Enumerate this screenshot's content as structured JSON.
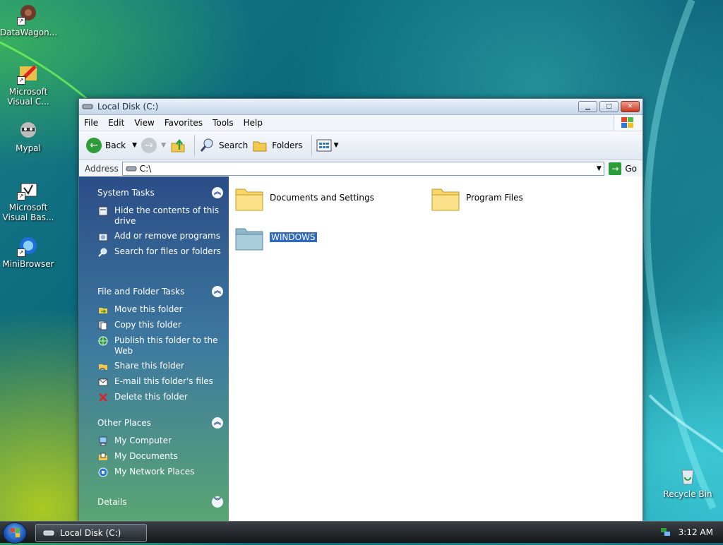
{
  "desktop": {
    "icons": [
      {
        "label": "DataWagon..."
      },
      {
        "label": "Microsoft Visual C..."
      },
      {
        "label": "Mypal"
      },
      {
        "label": "Microsoft Visual Bas..."
      },
      {
        "label": "MiniBrowser"
      }
    ],
    "recycle_bin": "Recycle Bin"
  },
  "window": {
    "title": "Local Disk (C:)",
    "menu": [
      "File",
      "Edit",
      "View",
      "Favorites",
      "Tools",
      "Help"
    ],
    "toolbar": {
      "back": "Back",
      "search": "Search",
      "folders": "Folders"
    },
    "address": {
      "label": "Address",
      "value": "C:\\",
      "go": "Go"
    }
  },
  "sidepane": {
    "system_tasks": {
      "title": "System Tasks",
      "items": [
        "Hide the contents of this drive",
        "Add or remove programs",
        "Search for files or folders"
      ]
    },
    "file_folder_tasks": {
      "title": "File and Folder Tasks",
      "items": [
        "Move this folder",
        "Copy this folder",
        "Publish this folder to the Web",
        "Share this folder",
        "E-mail this folder's files",
        "Delete this folder"
      ]
    },
    "other_places": {
      "title": "Other Places",
      "items": [
        "My Computer",
        "My Documents",
        "My Network Places"
      ]
    },
    "details": {
      "title": "Details"
    }
  },
  "content": {
    "folders": [
      "Documents and Settings",
      "Program Files",
      "WINDOWS"
    ],
    "selected": "WINDOWS"
  },
  "taskbar": {
    "task_label": "Local Disk (C:)",
    "clock": "3:12 AM"
  }
}
